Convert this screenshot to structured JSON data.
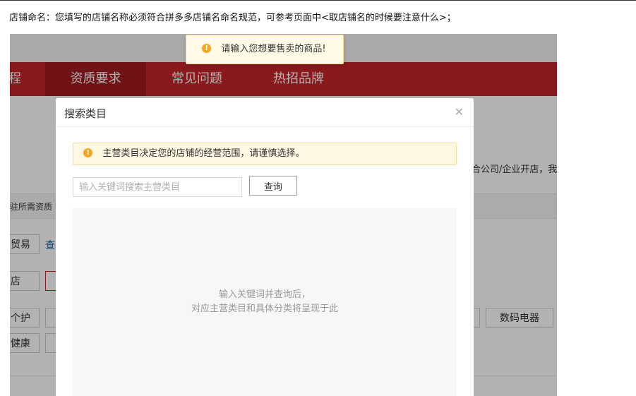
{
  "page_notice": "店铺命名：您填写的店铺名称必须符合拼多多店铺名命名规范，可参考页面中<取店铺名的时候要注意什么>；",
  "toast": {
    "icon": "warning-icon",
    "text": "请输入您想要售卖的商品!"
  },
  "background_page": {
    "nav_items": [
      "程",
      "资质要求",
      "常见问题",
      "热招品牌"
    ],
    "side_text": "合公司/企业开店，我",
    "section_label": "驻所需资质",
    "left_tags": [
      "贸易",
      "店",
      "个护",
      "健康"
    ],
    "link_text": "查",
    "right_button": "数码电器"
  },
  "modal": {
    "title": "搜索类目",
    "close_icon": "close-icon",
    "alert_text": "主营类目决定您的店铺的经营范围，请谨慎选择。",
    "search_placeholder": "输入关键词搜索主营类目",
    "query_button": "查询",
    "empty_hint_line1": "输入关键词并查询后，",
    "empty_hint_line2": "对应主营类目和具体分类将呈现于此"
  },
  "colors": {
    "brand_red": "#c4242a",
    "warning": "#f5a623",
    "alert_bg": "#fef8e3"
  }
}
